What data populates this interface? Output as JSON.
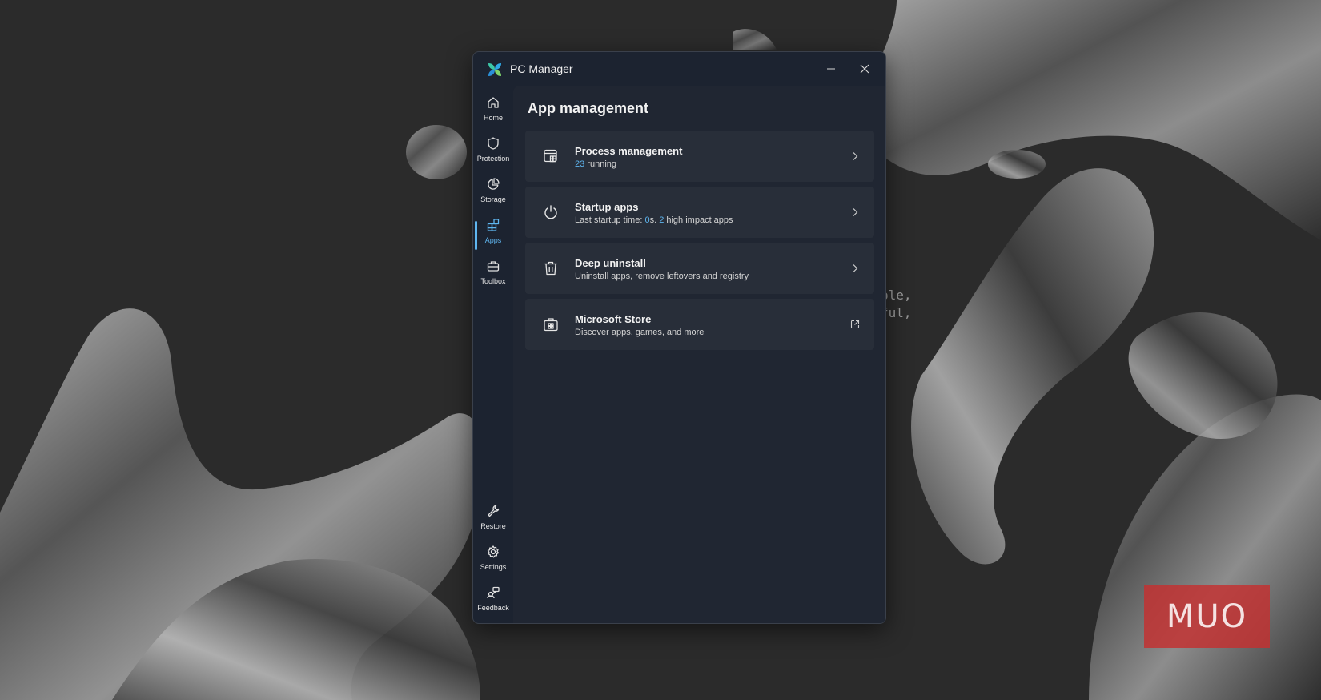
{
  "window": {
    "title": "PC Manager"
  },
  "background": {
    "code_lines": [
      "ple,",
      "ful,",
      "."
    ],
    "watermark": "MUO"
  },
  "sidebar": {
    "top_items": [
      {
        "label": "Home",
        "icon": "home-icon",
        "active": false
      },
      {
        "label": "Protection",
        "icon": "shield-icon",
        "active": false
      },
      {
        "label": "Storage",
        "icon": "pie-chart-icon",
        "active": false
      },
      {
        "label": "Apps",
        "icon": "apps-icon",
        "active": true
      },
      {
        "label": "Toolbox",
        "icon": "toolbox-icon",
        "active": false
      }
    ],
    "bottom_items": [
      {
        "label": "Restore",
        "icon": "wrench-icon"
      },
      {
        "label": "Settings",
        "icon": "gear-icon"
      },
      {
        "label": "Feedback",
        "icon": "feedback-icon"
      }
    ]
  },
  "main": {
    "title": "App management",
    "cards": [
      {
        "title": "Process management",
        "count": "23",
        "sub_text": " running",
        "icon": "process-window-icon",
        "action": "chevron-right-icon"
      },
      {
        "title": "Startup apps",
        "sub_prefix": "Last startup time: ",
        "startup_time": "0",
        "sub_mid": "s. ",
        "high_impact_count": "2",
        "sub_suffix": " high impact apps",
        "icon": "power-icon",
        "action": "chevron-right-icon"
      },
      {
        "title": "Deep uninstall",
        "sub_text": "Uninstall apps, remove leftovers and registry",
        "icon": "trash-icon",
        "action": "chevron-right-icon"
      },
      {
        "title": "Microsoft Store",
        "sub_text": "Discover apps, games, and more",
        "icon": "store-icon",
        "action": "external-link-icon"
      }
    ]
  },
  "colors": {
    "accent": "#5fb6f0",
    "window_bg": "#1c2330",
    "content_bg": "#202632",
    "card_bg": "#282e39",
    "desktop_bg": "#2b2b2b"
  }
}
